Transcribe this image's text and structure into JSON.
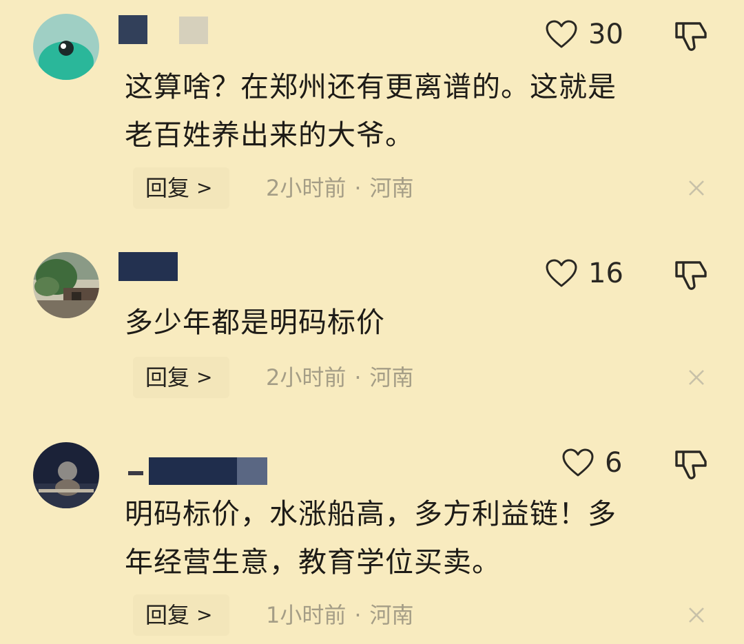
{
  "comments": [
    {
      "likes": "30",
      "text_lines": [
        "这算啥？在郑州还有更离谱的。这就是",
        "老百姓养出来的大爷。"
      ],
      "reply_label": "回复",
      "time": "2小时前",
      "location": "河南"
    },
    {
      "likes": "16",
      "text_lines": [
        "多少年都是明码标价"
      ],
      "reply_label": "回复",
      "time": "2小时前",
      "location": "河南"
    },
    {
      "likes": "6",
      "text_lines": [
        "明码标价，水涨船高，多方利益链！多",
        "年经营生意，教育学位买卖。"
      ],
      "reply_label": "回复",
      "time": "1小时前",
      "location": "河南"
    }
  ],
  "meta_separator": "·",
  "icons": {
    "like": "heart-icon",
    "dislike": "thumbs-down-icon",
    "reply_chevron": "chevron-right-icon",
    "close": "close-icon"
  },
  "colors": {
    "background": "#f8ebbf",
    "text": "#1d1b17",
    "meta": "#a49d86"
  }
}
